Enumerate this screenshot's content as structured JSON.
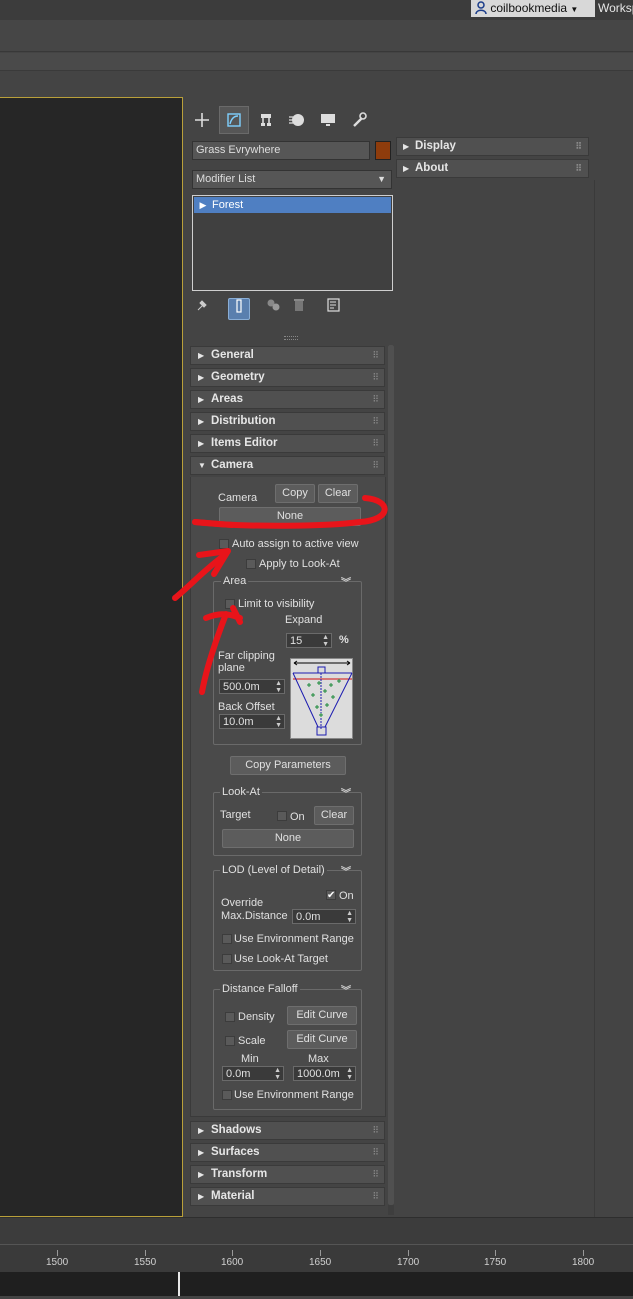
{
  "header": {
    "user_name": "coilbookmedia",
    "workspace_label": "Worksp"
  },
  "command_panel": {
    "tabs": [
      "create-icon",
      "modify-icon",
      "hierarchy-icon",
      "motion-icon",
      "display-icon",
      "utilities-icon"
    ],
    "active_tab": "modify-icon",
    "object_name": "Grass Evrywhere",
    "object_color": "#8e3c0c",
    "modifier_list_label": "Modifier List",
    "stack": [
      {
        "label": "Forest",
        "selected": true
      }
    ],
    "stack_tools": [
      "pin-stack-icon",
      "show-end-result-icon",
      "make-unique-icon",
      "remove-modifier-icon",
      "configure-modifier-sets-icon"
    ]
  },
  "rollouts_top": [
    "General",
    "Geometry",
    "Areas",
    "Distribution",
    "Items Editor"
  ],
  "camera": {
    "title": "Camera",
    "camera_label": "Camera",
    "copy_label": "Copy",
    "clear_label": "Clear",
    "none_label": "None",
    "auto_assign_label": "Auto assign to active view",
    "auto_assign_checked": false,
    "apply_lookat_label": "Apply to Look-At",
    "apply_lookat_checked": false,
    "area": {
      "title": "Area",
      "limit_label": "Limit to visibility",
      "limit_checked": false,
      "expand_label": "Expand",
      "expand_value": "15",
      "percent": "%",
      "far_clipping_label": "Far clipping plane",
      "far_clipping_value": "500.0m",
      "back_offset_label": "Back Offset",
      "back_offset_value": "10.0m"
    },
    "copy_parameters_label": "Copy Parameters",
    "lookat": {
      "title": "Look-At",
      "target_label": "Target",
      "on_label": "On",
      "on_checked": false,
      "clear_label": "Clear",
      "none_label": "None"
    },
    "lod": {
      "title": "LOD (Level of Detail)",
      "on_label": "On",
      "on_checked": true,
      "override_label": "Override",
      "max_distance_label": "Max.Distance",
      "max_distance_value": "0.0m",
      "use_env_range_label": "Use Environment Range",
      "use_lookat_target_label": "Use Look-At Target"
    },
    "falloff": {
      "title": "Distance Falloff",
      "density_label": "Density",
      "scale_label": "Scale",
      "edit_curve_label": "Edit Curve",
      "min_label": "Min",
      "max_label": "Max",
      "min_value": "0.0m",
      "max_value": "1000.0m",
      "use_env_range_label": "Use Environment Range"
    }
  },
  "rollouts_bottom": [
    "Shadows",
    "Surfaces",
    "Transform",
    "Material"
  ],
  "right_rollouts": [
    "Display",
    "About"
  ],
  "timeline": {
    "ticks": [
      "1500",
      "1550",
      "1600",
      "1650",
      "1700",
      "1750",
      "1800"
    ]
  },
  "annotation_color": "#e8141a"
}
